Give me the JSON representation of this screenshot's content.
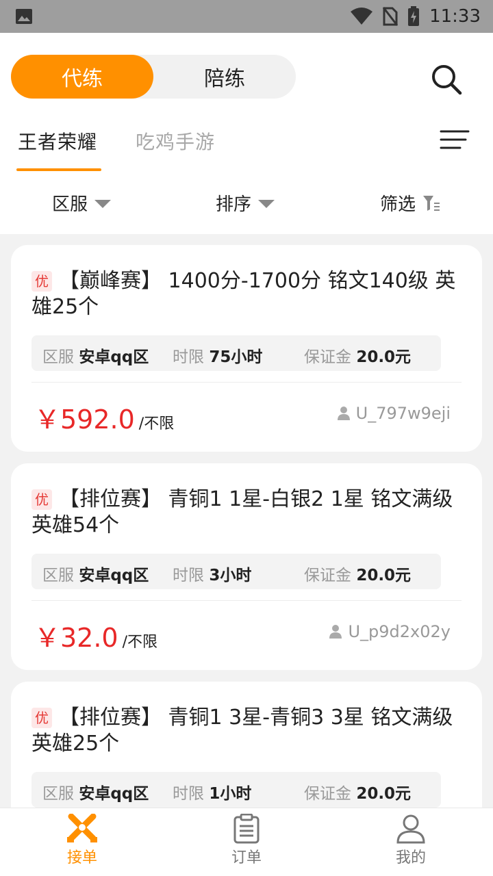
{
  "status_bar": {
    "time": "11:33"
  },
  "header": {
    "mode_tabs": [
      {
        "label": "代练",
        "active": true
      },
      {
        "label": "陪练",
        "active": false
      }
    ],
    "game_tabs": [
      {
        "label": "王者荣耀",
        "active": true
      },
      {
        "label": "吃鸡手游",
        "active": false
      }
    ],
    "filters": [
      {
        "label": "区服"
      },
      {
        "label": "排序"
      },
      {
        "label": "筛选"
      }
    ]
  },
  "orders": [
    {
      "badge": "优",
      "title": "【巅峰赛】 1400分-1700分 铭文140级 英雄25个",
      "region_label": "区服",
      "region": "安卓qq区",
      "time_label": "时限",
      "time_limit": "75小时",
      "deposit_label": "保证金",
      "deposit": "20.0元",
      "price": "￥592.0",
      "price_unit": "/不限",
      "seller": "U_797w9eji"
    },
    {
      "badge": "优",
      "title": "【排位赛】 青铜1 1星-白银2 1星 铭文满级 英雄54个",
      "region_label": "区服",
      "region": "安卓qq区",
      "time_label": "时限",
      "time_limit": "3小时",
      "deposit_label": "保证金",
      "deposit": "20.0元",
      "price": "￥32.0",
      "price_unit": "/不限",
      "seller": "U_p9d2x02y"
    },
    {
      "badge": "优",
      "title": "【排位赛】 青铜1 3星-青铜3 3星 铭文满级 英雄25个",
      "region_label": "区服",
      "region": "安卓qq区",
      "time_label": "时限",
      "time_limit": "1小时",
      "deposit_label": "保证金",
      "deposit": "20.0元",
      "price": "",
      "price_unit": "",
      "seller": ""
    }
  ],
  "bottom_nav": [
    {
      "label": "接单",
      "icon": "swords-icon",
      "active": true
    },
    {
      "label": "订单",
      "icon": "clipboard-icon",
      "active": false
    },
    {
      "label": "我的",
      "icon": "user-icon",
      "active": false
    }
  ],
  "colors": {
    "accent": "#ff9000",
    "price": "#e82828"
  }
}
